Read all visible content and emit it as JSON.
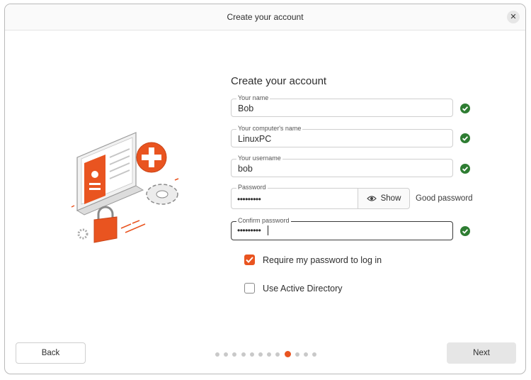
{
  "window": {
    "title": "Create your account"
  },
  "form": {
    "heading": "Create your account",
    "name": {
      "label": "Your name",
      "value": "Bob"
    },
    "computer_name": {
      "label": "Your computer's name",
      "value": "LinuxPC"
    },
    "username": {
      "label": "Your username",
      "value": "bob"
    },
    "password": {
      "label": "Password",
      "value": "•••••••••",
      "show_label": "Show",
      "strength": "Good password"
    },
    "confirm_password": {
      "label": "Confirm password",
      "value": "•••••••••"
    },
    "require_password": {
      "label": "Require my password to log in",
      "checked": true
    },
    "active_directory": {
      "label": "Use Active Directory",
      "checked": false
    }
  },
  "nav": {
    "back_label": "Back",
    "next_label": "Next",
    "step_count": 12,
    "current_step": 9
  },
  "colors": {
    "accent": "#e95420",
    "valid": "#2e7d32"
  },
  "icons": {
    "close": "close-icon",
    "valid": "check-circle-icon",
    "show": "eye-icon",
    "checkbox": "checkmark-icon"
  }
}
